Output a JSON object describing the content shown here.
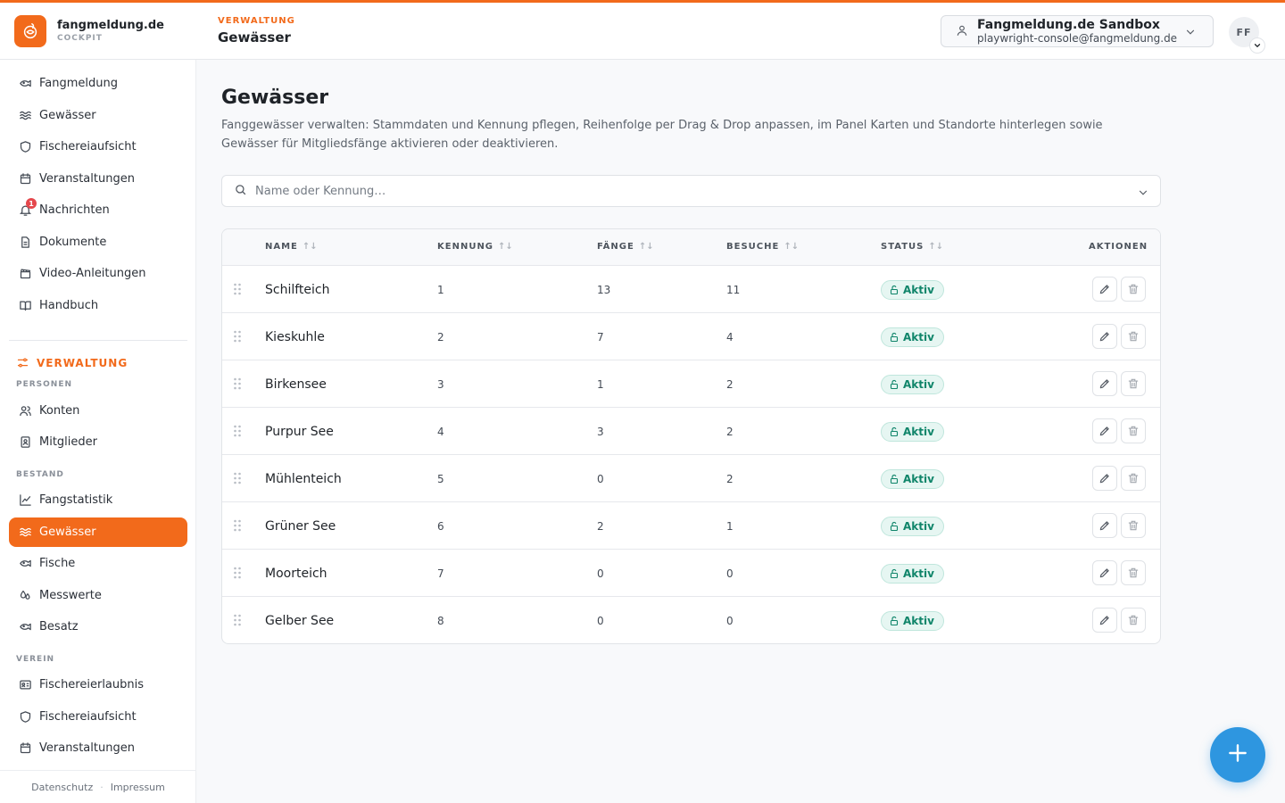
{
  "app": {
    "brand_name": "fangmeldung.de",
    "brand_sub": "COCKPIT"
  },
  "header": {
    "section": "VERWALTUNG",
    "title": "Gewässer",
    "tenant_name": "Fangmeldung.de Sandbox",
    "tenant_email": "playwright-console@fangmeldung.de",
    "avatar_initials": "FF"
  },
  "sidebar": {
    "main_items": [
      {
        "label": "Fangmeldung",
        "icon": "fish-icon"
      },
      {
        "label": "Gewässer",
        "icon": "waves-icon"
      },
      {
        "label": "Fischereiaufsicht",
        "icon": "shield-icon"
      },
      {
        "label": "Veranstaltungen",
        "icon": "calendar-icon"
      },
      {
        "label": "Nachrichten",
        "icon": "bell-icon",
        "badge": "1"
      },
      {
        "label": "Dokumente",
        "icon": "document-icon"
      },
      {
        "label": "Video-Anleitungen",
        "icon": "clapperboard-icon"
      },
      {
        "label": "Handbuch",
        "icon": "book-icon"
      }
    ],
    "admin_section": "VERWALTUNG",
    "groups": {
      "personen": "PERSONEN",
      "bestand": "BESTAND",
      "verein": "VEREIN"
    },
    "personen_items": [
      {
        "label": "Konten",
        "icon": "users-icon"
      },
      {
        "label": "Mitglieder",
        "icon": "member-card-icon"
      }
    ],
    "bestand_items": [
      {
        "label": "Fangstatistik",
        "icon": "chart-line-icon"
      },
      {
        "label": "Gewässer",
        "icon": "waves-icon",
        "active": true
      },
      {
        "label": "Fische",
        "icon": "fish-icon"
      },
      {
        "label": "Messwerte",
        "icon": "droplets-icon"
      },
      {
        "label": "Besatz",
        "icon": "fish-icon"
      }
    ],
    "verein_items": [
      {
        "label": "Fischereierlaubnis",
        "icon": "id-card-icon"
      },
      {
        "label": "Fischereiaufsicht",
        "icon": "shield-icon"
      },
      {
        "label": "Veranstaltungen",
        "icon": "calendar-icon"
      }
    ],
    "footer": {
      "privacy": "Datenschutz",
      "imprint": "Impressum"
    }
  },
  "main": {
    "title": "Gewässer",
    "description": "Fanggewässer verwalten: Stammdaten und Kennung pflegen, Reihenfolge per Drag & Drop anpassen, im Panel Karten und Standorte hinterlegen sowie Gewässer für Mitgliedsfänge aktivieren oder deaktivieren.",
    "search_placeholder": "Name oder Kennung…"
  },
  "table": {
    "columns": {
      "name": "NAME",
      "kennung": "KENNUNG",
      "faenge": "FÄNGE",
      "besuche": "BESUCHE",
      "status": "STATUS",
      "aktionen": "AKTIONEN"
    },
    "rows": [
      {
        "name": "Schilfteich",
        "kennung": "1",
        "faenge": "13",
        "besuche": "11",
        "status": "Aktiv"
      },
      {
        "name": "Kieskuhle",
        "kennung": "2",
        "faenge": "7",
        "besuche": "4",
        "status": "Aktiv"
      },
      {
        "name": "Birkensee",
        "kennung": "3",
        "faenge": "1",
        "besuche": "2",
        "status": "Aktiv"
      },
      {
        "name": "Purpur See",
        "kennung": "4",
        "faenge": "3",
        "besuche": "2",
        "status": "Aktiv"
      },
      {
        "name": "Mühlenteich",
        "kennung": "5",
        "faenge": "0",
        "besuche": "2",
        "status": "Aktiv"
      },
      {
        "name": "Grüner See",
        "kennung": "6",
        "faenge": "2",
        "besuche": "1",
        "status": "Aktiv"
      },
      {
        "name": "Moorteich",
        "kennung": "7",
        "faenge": "0",
        "besuche": "0",
        "status": "Aktiv"
      },
      {
        "name": "Gelber See",
        "kennung": "8",
        "faenge": "0",
        "besuche": "0",
        "status": "Aktiv"
      }
    ]
  },
  "colors": {
    "accent": "#f26a1b",
    "fab": "#2e96e0",
    "status_active": "#10856a",
    "badge": "#e5484d"
  }
}
